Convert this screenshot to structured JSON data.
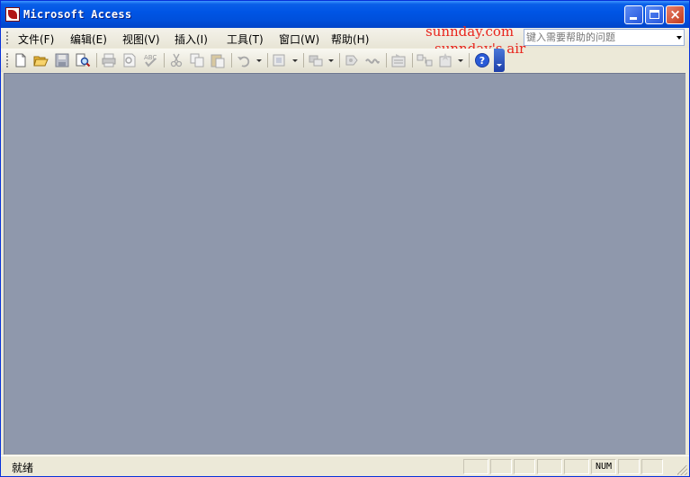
{
  "window": {
    "title": "Microsoft Access",
    "buttons": {
      "minimize": "minimize",
      "maximize": "maximize",
      "close": "×"
    }
  },
  "menubar": {
    "items": [
      {
        "label": "文件(F)"
      },
      {
        "label": "编辑(E)"
      },
      {
        "label": "视图(V)"
      },
      {
        "label": "插入(I)"
      },
      {
        "label": "工具(T)"
      },
      {
        "label": "窗口(W)"
      },
      {
        "label": "帮助(H)"
      }
    ],
    "help_box": {
      "placeholder": "键入需要帮助的问题"
    }
  },
  "overlay": {
    "line1": "sunnday.com",
    "line2": "sunnday's air",
    "color": "#e8241c"
  },
  "toolbar": {
    "icons": [
      "new-icon",
      "open-icon",
      "save-icon",
      "file-search-icon",
      "print-icon",
      "print-preview-icon",
      "spelling-icon",
      "cut-icon",
      "copy-icon",
      "paste-icon",
      "undo-icon",
      "office-links-icon",
      "analyze-icon",
      "code-icon",
      "script-icon",
      "properties-icon",
      "relationships-icon",
      "new-object-icon",
      "help-icon",
      "toolbar-options-icon"
    ]
  },
  "statusbar": {
    "text": "就绪",
    "num_indicator": "NUM"
  },
  "colors": {
    "titlebar": "#0055e5",
    "workspace": "#8f98ac",
    "chrome": "#ece9d8"
  }
}
